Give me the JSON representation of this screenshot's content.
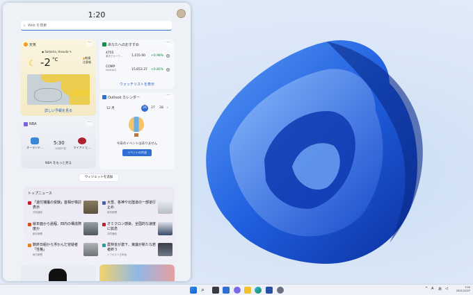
{
  "widgets": {
    "clock": "1:20",
    "search_placeholder": "Web を検索"
  },
  "weather": {
    "title": "天気",
    "location": "Saitama, Hasuda",
    "temperature": "-2",
    "unit": "°C",
    "condition_1": "乾燥",
    "condition_2": "注意報",
    "link": "詳しい予報を見る"
  },
  "stocks": {
    "title": "あなたへのおすすめ",
    "rows": [
      {
        "name": "4755",
        "sub": "楽天グループ...",
        "value": "1,155.00",
        "change": "+0.98%"
      },
      {
        "name": "COMP",
        "sub": "NASDAQ",
        "value": "15,653.37",
        "change": "+0.85%"
      }
    ],
    "link": "ウォッチリストを表示"
  },
  "calendar": {
    "title": "Outlook カレンダー",
    "month": "12 月",
    "days": [
      "26",
      "27",
      "28"
    ],
    "more": "›",
    "empty": "今日のイベントはありません",
    "button": "イベントの作成"
  },
  "nba": {
    "title": "NBA",
    "home_team": "オーランド...",
    "away_team": "マイアミ ヒ...",
    "time": "5:30",
    "date": "12月27日",
    "link": "NBA をもっと見る"
  },
  "add_widget": "ウィジェットを追加",
  "news": {
    "title": "トップニュース",
    "items": [
      {
        "headline": "「還付捕獲の受験」首相が検討表示",
        "source": "共同通信"
      },
      {
        "headline": "大雪、各神や北陸道の一部道行止め",
        "source": "読売新聞"
      },
      {
        "headline": "就年面から過程、四内の構造際度か",
        "source": "朝日新聞"
      },
      {
        "headline": "オミクロン感染、全国的な速度に拡念",
        "source": "共同通信"
      },
      {
        "headline": "数終日組から浮かんだ容疑者「性格」",
        "source": "毎日新聞"
      },
      {
        "headline": "農林省が激下、東議が新たな若者終う",
        "source": "ハフポスト日本版"
      }
    ]
  },
  "taskbar": {
    "lang": "A",
    "ime": "あ",
    "time": "1:20",
    "date": "2021/12/27"
  },
  "colors": {
    "accent": "#2f6ed3",
    "positive": "#0a8a3a",
    "wallpaper": "#1f5fe0"
  }
}
